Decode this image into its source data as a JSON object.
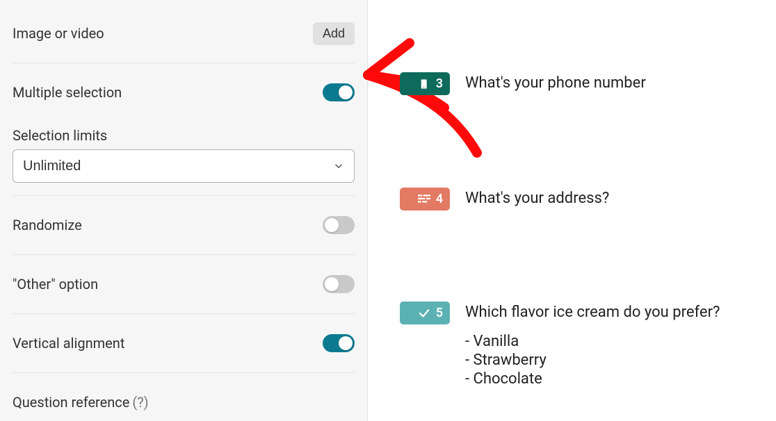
{
  "panel": {
    "image_or_video_label": "Image or video",
    "add_button": "Add",
    "multiple_selection_label": "Multiple selection",
    "multiple_selection_on": true,
    "selection_limits_label": "Selection limits",
    "selection_limits_value": "Unlimited",
    "randomize_label": "Randomize",
    "randomize_on": false,
    "other_option_label": "\"Other\" option",
    "other_option_on": false,
    "vertical_alignment_label": "Vertical alignment",
    "vertical_alignment_on": true,
    "question_reference_label": "Question reference",
    "question_reference_help": "(?)"
  },
  "questions": [
    {
      "number": "3",
      "title": "What's your phone number"
    },
    {
      "number": "4",
      "title": "What's your address?"
    },
    {
      "number": "5",
      "title": "Which flavor ice cream do you prefer?",
      "options": [
        "-  Vanilla",
        "-  Strawberry",
        "-  Chocolate"
      ]
    }
  ]
}
